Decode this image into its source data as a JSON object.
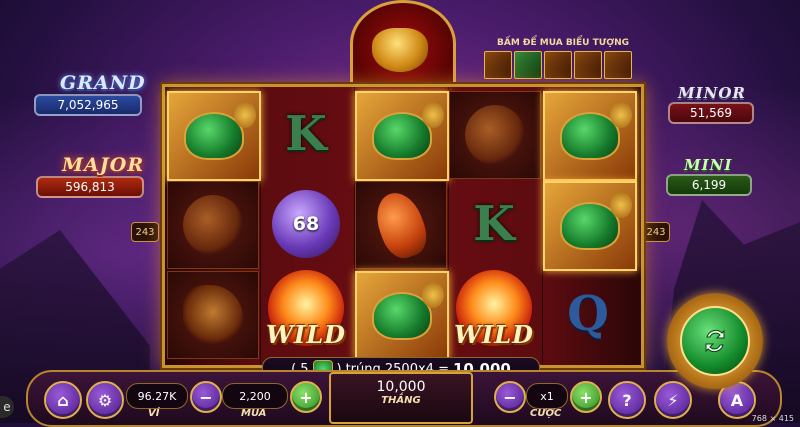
{
  "jackpots": {
    "grand": {
      "label": "GRAND",
      "value": "7,052,965"
    },
    "major": {
      "label": "MAJOR",
      "value": "596,813"
    },
    "minor": {
      "label": "MINOR",
      "value": "51,569"
    },
    "mini": {
      "label": "MINI",
      "value": "6,199"
    }
  },
  "ways": {
    "left": "243",
    "right": "243"
  },
  "buy_feature": {
    "title": "BẤM ĐỂ MUA BIỂU TƯỢNG"
  },
  "reels": {
    "reel1": [
      "turtle",
      "dragon",
      "phoenix"
    ],
    "reel2": [
      "K",
      "68",
      "WILD"
    ],
    "reel3": [
      "turtle",
      "koi",
      "turtle"
    ],
    "reel4": [
      "dragon",
      "K",
      "WILD"
    ],
    "reel5": [
      "turtle",
      "turtle",
      "Q"
    ]
  },
  "symbols": {
    "k": "K",
    "q": "Q",
    "orb_value": "68",
    "wild": "WILD"
  },
  "win_line": {
    "count": "5",
    "text_before": "(",
    "text_after": ")",
    "formula": "trúng 2500x4 =",
    "amount": "10,000"
  },
  "bottom_bar": {
    "wallet": {
      "value": "96.27K",
      "label": "VÍ"
    },
    "buy": {
      "value": "2,200",
      "label": "MUA",
      "minus": "−",
      "plus": "+"
    },
    "win": {
      "value": "10,000",
      "label": "THẮNG"
    },
    "bet": {
      "value": "x1",
      "label": "CƯỢC",
      "minus": "−",
      "plus": "+"
    },
    "help": "?",
    "turbo": "⚡",
    "auto": "A",
    "home": "⌂",
    "settings": "⚙"
  },
  "corner_text": "768 × 415",
  "left_edge_glyph": "e"
}
